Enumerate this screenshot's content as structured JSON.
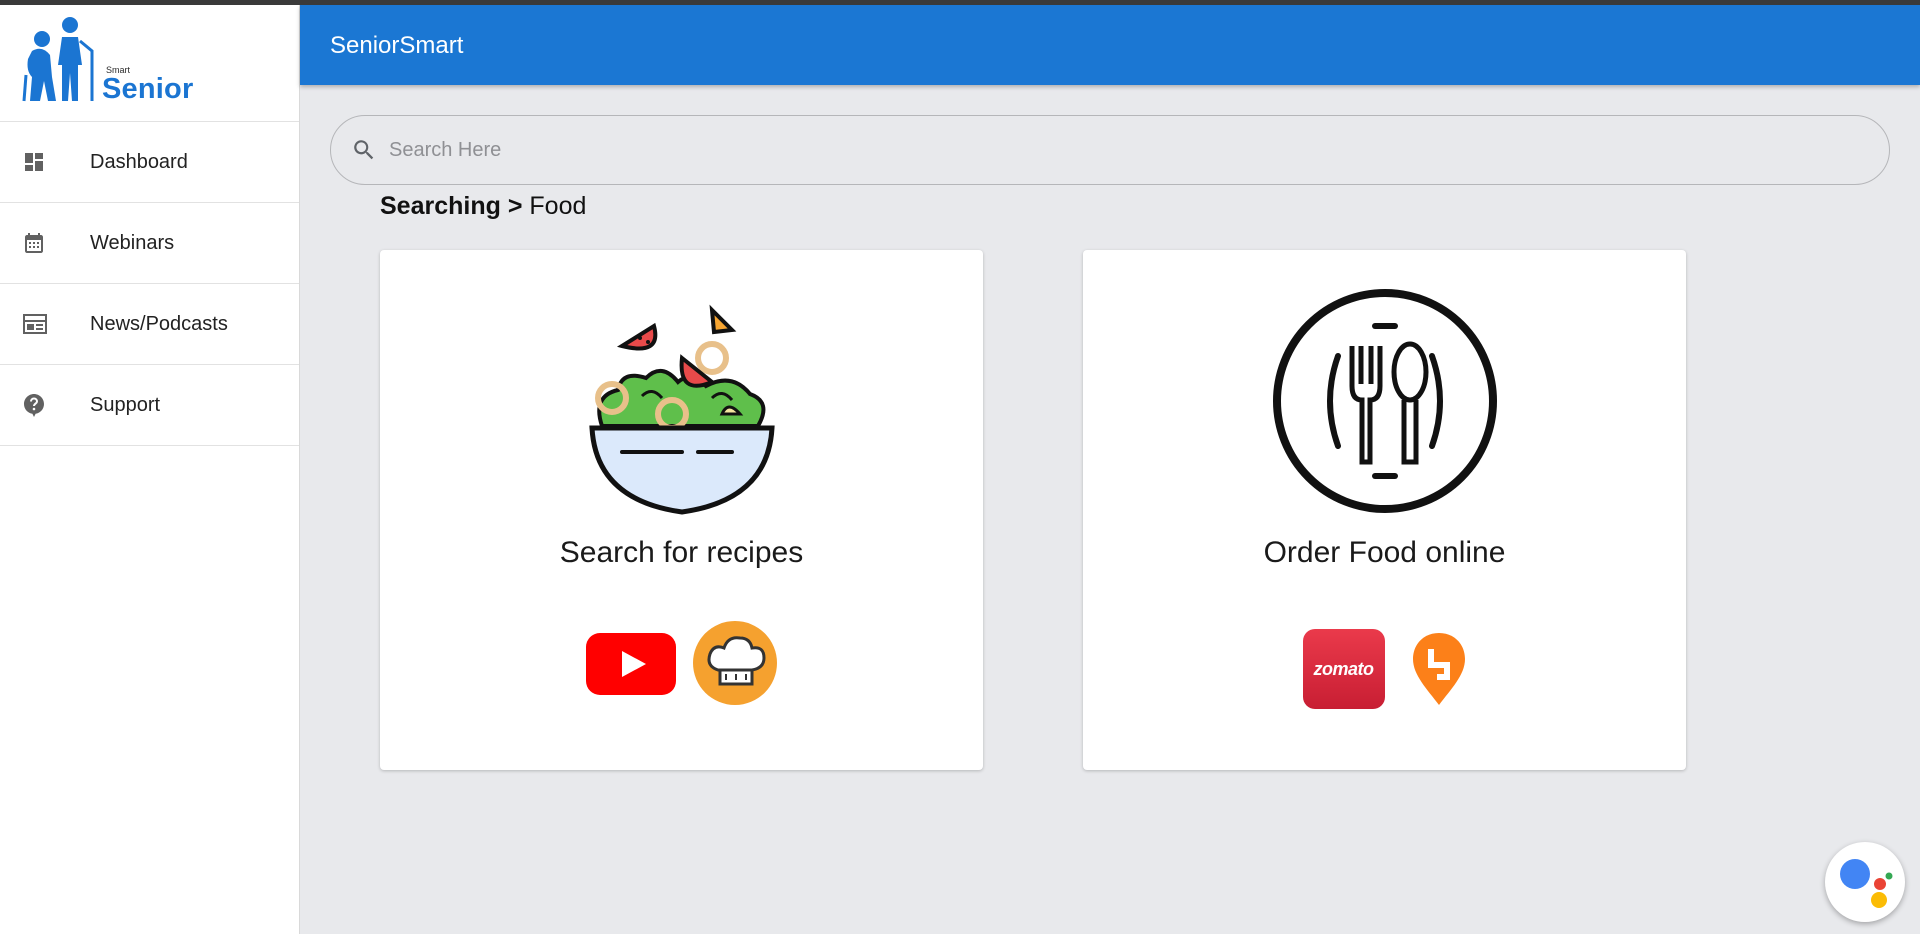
{
  "logo": {
    "small": "Smart",
    "big": "Senior"
  },
  "sidebar": {
    "items": [
      {
        "label": "Dashboard",
        "icon": "dashboard-icon"
      },
      {
        "label": "Webinars",
        "icon": "calendar-icon"
      },
      {
        "label": "News/Podcasts",
        "icon": "news-icon"
      },
      {
        "label": "Support",
        "icon": "help-icon"
      }
    ]
  },
  "header": {
    "title": "SeniorSmart"
  },
  "search": {
    "placeholder": "Search Here",
    "value": ""
  },
  "breadcrumb": {
    "parent": "Searching",
    "separator": ">",
    "current": "Food"
  },
  "cards": [
    {
      "title": "Search for recipes",
      "icon": "salad-bowl-icon",
      "apps": [
        "youtube-icon",
        "chef-hat-icon"
      ]
    },
    {
      "title": "Order Food online",
      "icon": "fork-spoon-plate-icon",
      "apps": [
        "zomato-icon",
        "swiggy-icon"
      ],
      "zomato_text": "zomato"
    }
  ],
  "colors": {
    "header": "#1b77d3",
    "logo": "#1b75d2",
    "background": "#e8e9ec",
    "zomato": "#e23744",
    "swiggy": "#fc8019",
    "youtube": "#ff0000",
    "chef": "#f5a623"
  }
}
